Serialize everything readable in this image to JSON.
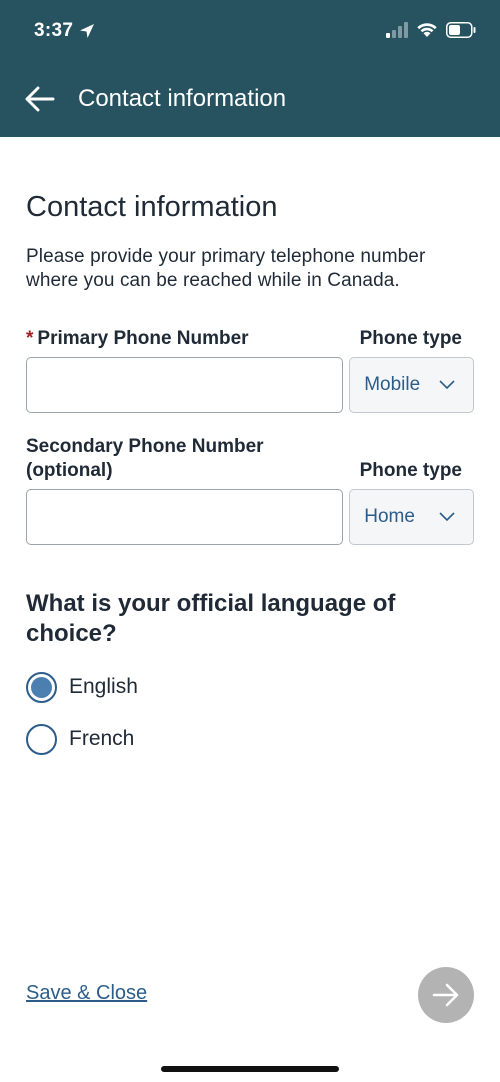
{
  "status_bar": {
    "time": "3:37",
    "icons": [
      "location-arrow-icon",
      "cellular-signal-icon",
      "wifi-icon",
      "battery-icon"
    ]
  },
  "app_bar": {
    "back_icon": "arrow-left-icon",
    "title": "Contact information"
  },
  "main": {
    "heading": "Contact information",
    "intro": "Please provide your primary telephone number where you can be reached while in Canada.",
    "primary_phone": {
      "required_marker": "*",
      "label": "Primary Phone Number",
      "value": "",
      "type_label": "Phone type",
      "type_value": "Mobile"
    },
    "secondary_phone": {
      "label_line1": "Secondary Phone Number",
      "label_line2": "(optional)",
      "value": "",
      "type_label": "Phone type",
      "type_value": "Home"
    },
    "language_question": "What is your official language of choice?",
    "language_options": [
      {
        "label": "English",
        "selected": true
      },
      {
        "label": "French",
        "selected": false
      }
    ]
  },
  "footer": {
    "save_close": "Save & Close",
    "next_icon": "arrow-right-icon"
  },
  "colors": {
    "header_bg": "#26535f",
    "link": "#2c5d8a",
    "radio_selected": "#4a7fb0",
    "required": "#a31e22",
    "next_button_disabled": "#b3b3b3"
  }
}
